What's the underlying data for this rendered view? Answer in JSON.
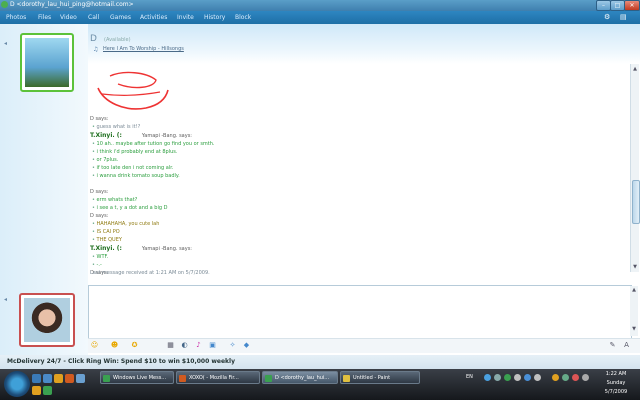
{
  "window": {
    "title": "D <dorothy_lau_hui_ping@hotmail.com>"
  },
  "menu": [
    "Photos",
    "Files",
    "Video",
    "Call",
    "Games",
    "Activities",
    "Invite",
    "History",
    "Block"
  ],
  "contact": {
    "name": "D",
    "status": "(Available)",
    "psm": "Here I Am To Worship - Hillsongs"
  },
  "history": [
    {
      "type": "says",
      "text": "D says:"
    },
    {
      "type": "msg-grey",
      "text": "guess what is it!?"
    },
    {
      "type": "says-bold",
      "text": "T.Xinyi. (:",
      "extra": "Yamapi       -Bang. says:"
    },
    {
      "type": "msg-green",
      "text": "10 ah.. maybe after tution go find you or smth."
    },
    {
      "type": "msg-green",
      "text": "i think i'd probably end at 8plus."
    },
    {
      "type": "msg-green",
      "text": "or 7plus."
    },
    {
      "type": "msg-green",
      "text": "if too late den i not coming alr."
    },
    {
      "type": "msg-green",
      "text": "i wanna drink tomato soup badly."
    },
    {
      "type": "says",
      "text": "D says:"
    },
    {
      "type": "msg-green",
      "text": "erm whats that?"
    },
    {
      "type": "msg-green",
      "text": "i see a t, y a dot and a big D"
    },
    {
      "type": "says",
      "text": "D says:"
    },
    {
      "type": "msg-olive",
      "text": "HAHAHAHA, you cute lah"
    },
    {
      "type": "msg-olive",
      "text": "IS CAI PO"
    },
    {
      "type": "msg-olive",
      "text": "THE QUEY"
    },
    {
      "type": "says-bold",
      "text": "T.Xinyi. (:",
      "extra": "Yamapi       -Bang. says:"
    },
    {
      "type": "msg-green",
      "text": "WTF."
    },
    {
      "type": "msg-green",
      "text": "-.-"
    },
    {
      "type": "says",
      "text": "D says:"
    }
  ],
  "last_received": "Last message received at 1:21 AM on 5/7/2009.",
  "ad": "McDelivery 24/7 - Click Ring Win: Spend $10 to win $10,000 weekly",
  "taskbar": {
    "tasks": [
      "Windows Live Mess...",
      "XOXO( - Mozilla Fir...",
      "D <dorothy_lau_hui...",
      "Untitled - Paint"
    ],
    "lang": "EN",
    "clock": {
      "time": "1:22 AM",
      "day": "Sunday",
      "date": "5/7/2009"
    }
  },
  "colors": {
    "menubar": "#1e6fa6",
    "green_text": "#2b9e3e",
    "olive_text": "#8f7a10",
    "avatar_border": "#5cc23a"
  }
}
